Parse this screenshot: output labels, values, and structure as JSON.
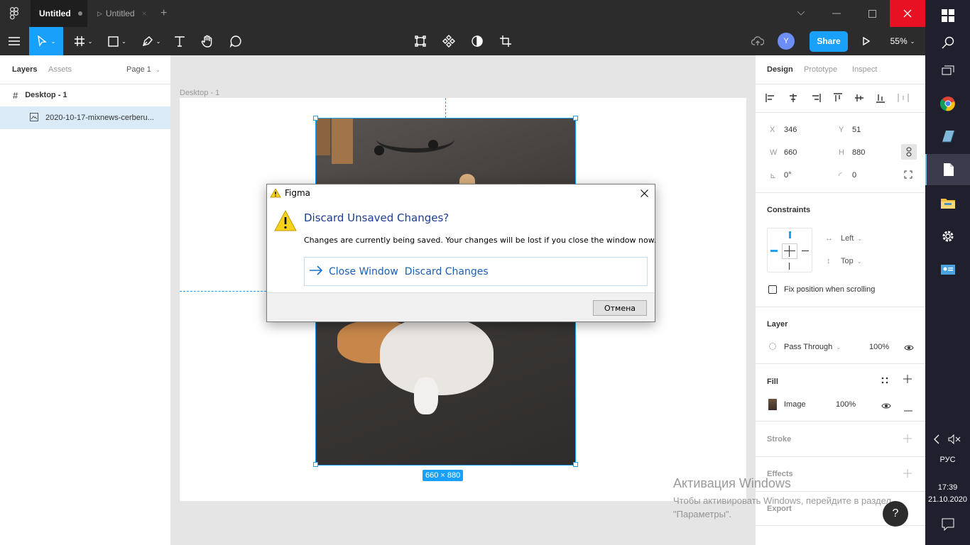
{
  "titlebar": {
    "tabs": [
      {
        "label": "Untitled",
        "active": true
      },
      {
        "label": "Untitled",
        "active": false
      }
    ],
    "add_tab": "+"
  },
  "toolbar": {
    "share_label": "Share",
    "avatar_letter": "Y",
    "zoom_label": "55%"
  },
  "left_panel": {
    "tab_layers": "Layers",
    "tab_assets": "Assets",
    "page_label": "Page 1",
    "layers": [
      {
        "label": "Desktop - 1",
        "icon": "frame-icon"
      },
      {
        "label": "2020-10-17-mixnews-cerberu...",
        "icon": "image-icon"
      }
    ]
  },
  "canvas": {
    "frame_label": "Desktop - 1",
    "size_badge": "660 × 880"
  },
  "dialog": {
    "window_title": "Figma",
    "heading": "Discard Unsaved Changes?",
    "message": "Changes are currently being saved. Your changes will be lost if you close the window now.",
    "command_link": "Close Window  Discard Changes",
    "cancel_label": "Отмена"
  },
  "right_panel": {
    "tabs": [
      "Design",
      "Prototype",
      "Inspect"
    ],
    "x_label": "X",
    "x_value": "346",
    "y_label": "Y",
    "y_value": "51",
    "w_label": "W",
    "w_value": "660",
    "h_label": "H",
    "h_value": "880",
    "rotation": "0°",
    "radius": "0",
    "constraints_title": "Constraints",
    "constraint_h": "Left",
    "constraint_v": "Top",
    "fix_position": "Fix position when scrolling",
    "layer_title": "Layer",
    "blend_mode": "Pass Through",
    "layer_opacity": "100%",
    "fill_title": "Fill",
    "fill_type": "Image",
    "fill_opacity": "100%",
    "stroke_title": "Stroke",
    "effects_title": "Effects",
    "export_title": "Export"
  },
  "watermark": {
    "line1": "Активация Windows",
    "line2": "Чтобы активировать Windows, перейдите в раздел \"Параметры\"."
  },
  "help_label": "?",
  "taskbar": {
    "lang": "РУС",
    "time": "17:39",
    "date": "21.10.2020"
  },
  "colors": {
    "accent": "#18a0fb",
    "toolbar_bg": "#2c2c2c",
    "close_red": "#e81123"
  }
}
